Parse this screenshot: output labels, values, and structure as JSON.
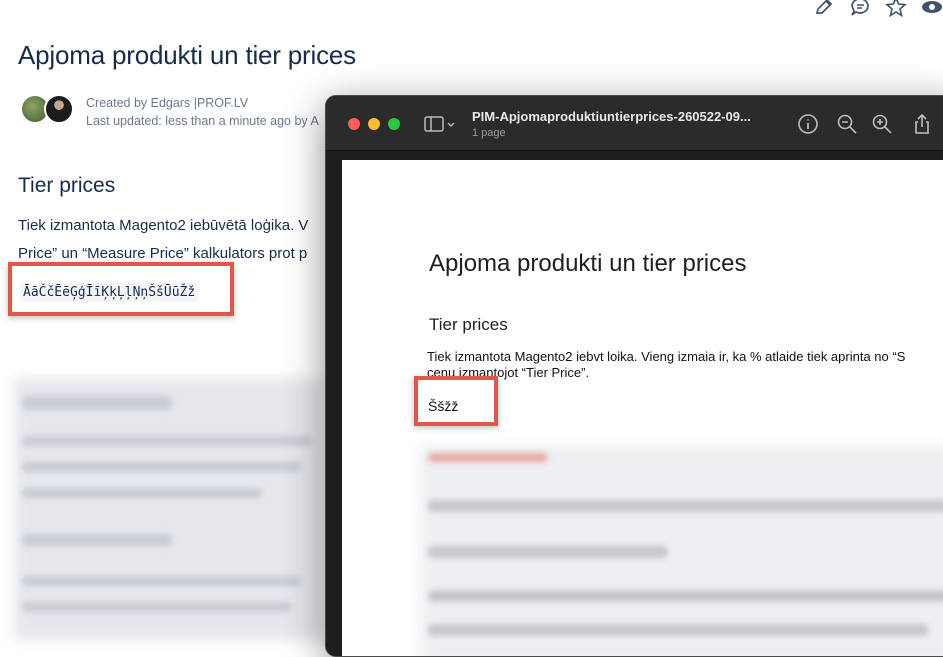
{
  "confluence": {
    "title": "Apjoma produkti un tier prices",
    "created_by": "Created by Edgars |PROF.LV",
    "last_updated": "Last updated: less than a minute ago by A",
    "section_heading": "Tier prices",
    "para_line1": "Tiek izmantota Magento2 iebūvētā loģika. V",
    "para_line2": "Price” un “Measure Price” kalkulators prot p",
    "special_chars": "ĀāČčĒēĢģĪīĶķĻļŅņŠšŪūŽž",
    "toolbar_icons": [
      "pencil-icon",
      "comment-icon",
      "star-icon",
      "eye-icon"
    ]
  },
  "preview": {
    "window_title": "PIM-Apjomaproduktiuntierprices-260522-09...",
    "page_count": "1 page",
    "doc_title": "Apjoma produkti un tier prices",
    "doc_heading": "Tier prices",
    "doc_line1": "Tiek izmantota Magento2 iebvt loika. Vieng izmaia ir, ka % atlaide tiek aprinta no “S",
    "doc_line2": "cenu izmantojot “Tier Price”.",
    "doc_chars": "Ššžž",
    "toolbar_icons": [
      "sidebar-icon",
      "info-icon",
      "zoom-out-icon",
      "zoom-in-icon",
      "share-icon"
    ]
  },
  "colors": {
    "highlight": "#e2574c",
    "traffic_close": "#ff5f57",
    "traffic_min": "#febc2e",
    "traffic_max": "#28c840"
  }
}
